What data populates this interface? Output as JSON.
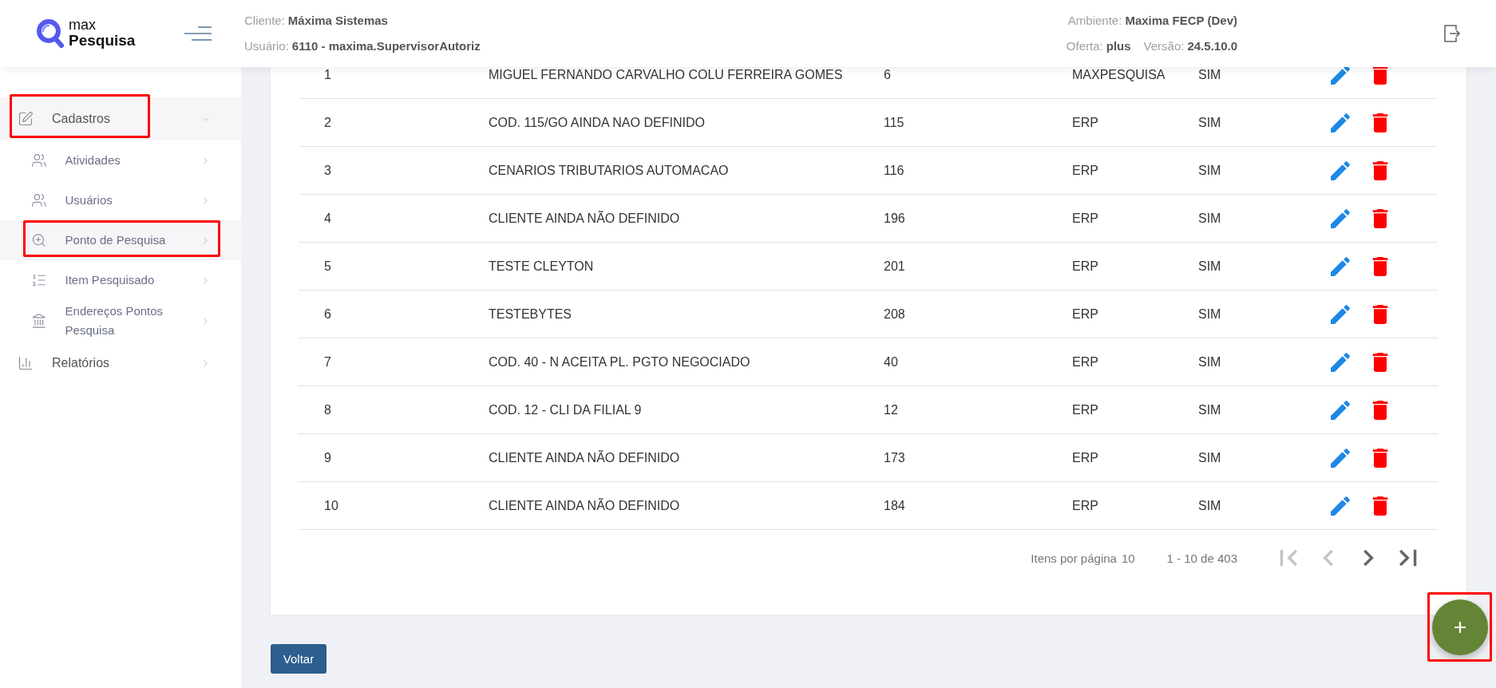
{
  "header": {
    "logo": {
      "top": "max",
      "bottom": "Pesquisa"
    },
    "info_left": [
      [
        {
          "label": "Cliente:",
          "value": "Máxima Sistemas"
        }
      ],
      [
        {
          "label": "Usuário:",
          "value": "6110 - maxima.SupervisorAutoriz"
        }
      ]
    ],
    "info_right": [
      [
        {
          "label": "Ambiente:",
          "value": "Maxima FECP (Dev)"
        }
      ],
      [
        {
          "label": "Oferta:",
          "value": "plus"
        },
        {
          "label": "Versão:",
          "value": "24.5.10.0"
        }
      ]
    ]
  },
  "sidebar": {
    "items": [
      {
        "label": "Cadastros",
        "expanded": true,
        "highlighted": true,
        "children": [
          {
            "label": "Atividades",
            "selected": false,
            "highlighted": false
          },
          {
            "label": "Usuários",
            "selected": false,
            "highlighted": false
          },
          {
            "label": "Ponto de Pesquisa",
            "selected": true,
            "highlighted": true
          },
          {
            "label": "Item Pesquisado",
            "selected": false,
            "highlighted": false
          },
          {
            "label": "Endereços Pontos Pesquisa",
            "selected": false,
            "highlighted": false
          }
        ]
      },
      {
        "label": "Relatórios",
        "expanded": false,
        "highlighted": false
      }
    ]
  },
  "table": {
    "rows": [
      {
        "cells": [
          "1",
          "MIGUEL FERNANDO CARVALHO COLU FERREIRA GOMES",
          "6",
          "MAXPESQUISA",
          "SIM"
        ]
      },
      {
        "cells": [
          "2",
          "COD. 115/GO AINDA NAO DEFINIDO",
          "115",
          "ERP",
          "SIM"
        ]
      },
      {
        "cells": [
          "3",
          "CENARIOS TRIBUTARIOS AUTOMACAO",
          "116",
          "ERP",
          "SIM"
        ]
      },
      {
        "cells": [
          "4",
          "CLIENTE AINDA NÃO DEFINIDO",
          "196",
          "ERP",
          "SIM"
        ]
      },
      {
        "cells": [
          "5",
          "TESTE CLEYTON",
          "201",
          "ERP",
          "SIM"
        ]
      },
      {
        "cells": [
          "6",
          "TESTEBYTES",
          "208",
          "ERP",
          "SIM"
        ]
      },
      {
        "cells": [
          "7",
          "COD. 40 - N ACEITA PL. PGTO NEGOCIADO",
          "40",
          "ERP",
          "SIM"
        ]
      },
      {
        "cells": [
          "8",
          "COD. 12 - CLI DA FILIAL 9",
          "12",
          "ERP",
          "SIM"
        ]
      },
      {
        "cells": [
          "9",
          "CLIENTE AINDA NÃO DEFINIDO",
          "173",
          "ERP",
          "SIM"
        ]
      },
      {
        "cells": [
          "10",
          "CLIENTE AINDA NÃO DEFINIDO",
          "184",
          "ERP",
          "SIM"
        ]
      }
    ]
  },
  "pagination": {
    "items_per_page_label": "Itens por página",
    "items_per_page": "10",
    "range": "1 - 10 de 403",
    "buttons": [
      {
        "kind": "first",
        "disabled": true
      },
      {
        "kind": "previous",
        "disabled": true
      },
      {
        "kind": "next",
        "disabled": false
      },
      {
        "kind": "last",
        "disabled": false
      }
    ]
  },
  "back_button": {
    "label": "Voltar"
  },
  "fab": {
    "highlighted": true
  }
}
